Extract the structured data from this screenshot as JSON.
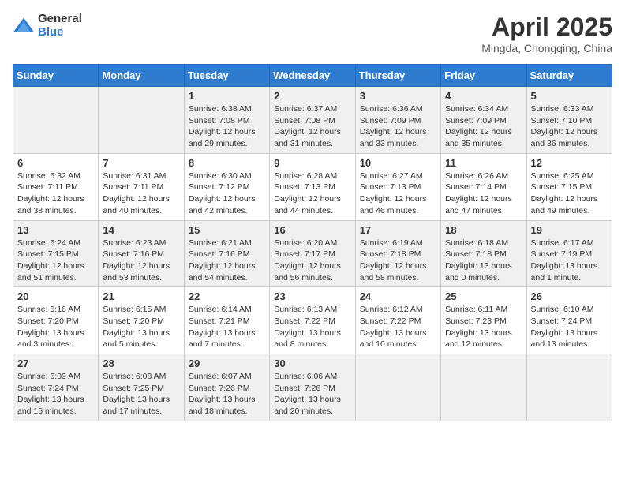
{
  "logo": {
    "general": "General",
    "blue": "Blue"
  },
  "header": {
    "month_year": "April 2025",
    "location": "Mingda, Chongqing, China"
  },
  "weekdays": [
    "Sunday",
    "Monday",
    "Tuesday",
    "Wednesday",
    "Thursday",
    "Friday",
    "Saturday"
  ],
  "weeks": [
    [
      {
        "day": "",
        "info": ""
      },
      {
        "day": "",
        "info": ""
      },
      {
        "day": "1",
        "info": "Sunrise: 6:38 AM\nSunset: 7:08 PM\nDaylight: 12 hours and 29 minutes."
      },
      {
        "day": "2",
        "info": "Sunrise: 6:37 AM\nSunset: 7:08 PM\nDaylight: 12 hours and 31 minutes."
      },
      {
        "day": "3",
        "info": "Sunrise: 6:36 AM\nSunset: 7:09 PM\nDaylight: 12 hours and 33 minutes."
      },
      {
        "day": "4",
        "info": "Sunrise: 6:34 AM\nSunset: 7:09 PM\nDaylight: 12 hours and 35 minutes."
      },
      {
        "day": "5",
        "info": "Sunrise: 6:33 AM\nSunset: 7:10 PM\nDaylight: 12 hours and 36 minutes."
      }
    ],
    [
      {
        "day": "6",
        "info": "Sunrise: 6:32 AM\nSunset: 7:11 PM\nDaylight: 12 hours and 38 minutes."
      },
      {
        "day": "7",
        "info": "Sunrise: 6:31 AM\nSunset: 7:11 PM\nDaylight: 12 hours and 40 minutes."
      },
      {
        "day": "8",
        "info": "Sunrise: 6:30 AM\nSunset: 7:12 PM\nDaylight: 12 hours and 42 minutes."
      },
      {
        "day": "9",
        "info": "Sunrise: 6:28 AM\nSunset: 7:13 PM\nDaylight: 12 hours and 44 minutes."
      },
      {
        "day": "10",
        "info": "Sunrise: 6:27 AM\nSunset: 7:13 PM\nDaylight: 12 hours and 46 minutes."
      },
      {
        "day": "11",
        "info": "Sunrise: 6:26 AM\nSunset: 7:14 PM\nDaylight: 12 hours and 47 minutes."
      },
      {
        "day": "12",
        "info": "Sunrise: 6:25 AM\nSunset: 7:15 PM\nDaylight: 12 hours and 49 minutes."
      }
    ],
    [
      {
        "day": "13",
        "info": "Sunrise: 6:24 AM\nSunset: 7:15 PM\nDaylight: 12 hours and 51 minutes."
      },
      {
        "day": "14",
        "info": "Sunrise: 6:23 AM\nSunset: 7:16 PM\nDaylight: 12 hours and 53 minutes."
      },
      {
        "day": "15",
        "info": "Sunrise: 6:21 AM\nSunset: 7:16 PM\nDaylight: 12 hours and 54 minutes."
      },
      {
        "day": "16",
        "info": "Sunrise: 6:20 AM\nSunset: 7:17 PM\nDaylight: 12 hours and 56 minutes."
      },
      {
        "day": "17",
        "info": "Sunrise: 6:19 AM\nSunset: 7:18 PM\nDaylight: 12 hours and 58 minutes."
      },
      {
        "day": "18",
        "info": "Sunrise: 6:18 AM\nSunset: 7:18 PM\nDaylight: 13 hours and 0 minutes."
      },
      {
        "day": "19",
        "info": "Sunrise: 6:17 AM\nSunset: 7:19 PM\nDaylight: 13 hours and 1 minute."
      }
    ],
    [
      {
        "day": "20",
        "info": "Sunrise: 6:16 AM\nSunset: 7:20 PM\nDaylight: 13 hours and 3 minutes."
      },
      {
        "day": "21",
        "info": "Sunrise: 6:15 AM\nSunset: 7:20 PM\nDaylight: 13 hours and 5 minutes."
      },
      {
        "day": "22",
        "info": "Sunrise: 6:14 AM\nSunset: 7:21 PM\nDaylight: 13 hours and 7 minutes."
      },
      {
        "day": "23",
        "info": "Sunrise: 6:13 AM\nSunset: 7:22 PM\nDaylight: 13 hours and 8 minutes."
      },
      {
        "day": "24",
        "info": "Sunrise: 6:12 AM\nSunset: 7:22 PM\nDaylight: 13 hours and 10 minutes."
      },
      {
        "day": "25",
        "info": "Sunrise: 6:11 AM\nSunset: 7:23 PM\nDaylight: 13 hours and 12 minutes."
      },
      {
        "day": "26",
        "info": "Sunrise: 6:10 AM\nSunset: 7:24 PM\nDaylight: 13 hours and 13 minutes."
      }
    ],
    [
      {
        "day": "27",
        "info": "Sunrise: 6:09 AM\nSunset: 7:24 PM\nDaylight: 13 hours and 15 minutes."
      },
      {
        "day": "28",
        "info": "Sunrise: 6:08 AM\nSunset: 7:25 PM\nDaylight: 13 hours and 17 minutes."
      },
      {
        "day": "29",
        "info": "Sunrise: 6:07 AM\nSunset: 7:26 PM\nDaylight: 13 hours and 18 minutes."
      },
      {
        "day": "30",
        "info": "Sunrise: 6:06 AM\nSunset: 7:26 PM\nDaylight: 13 hours and 20 minutes."
      },
      {
        "day": "",
        "info": ""
      },
      {
        "day": "",
        "info": ""
      },
      {
        "day": "",
        "info": ""
      }
    ]
  ]
}
